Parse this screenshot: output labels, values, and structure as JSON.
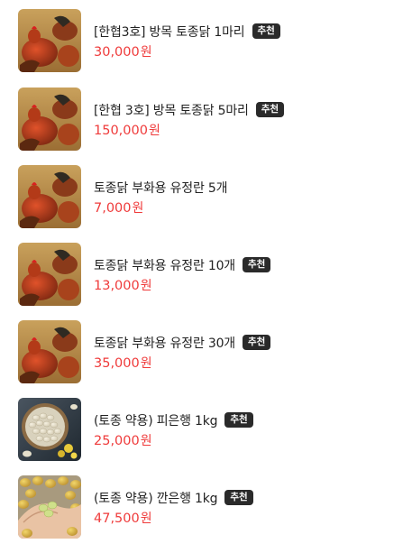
{
  "products": [
    {
      "name": "[한협3호] 방목 토종닭 1마리",
      "price": "30,000",
      "unit": "원",
      "badge": "추천",
      "image": "chicken-flock-photo"
    },
    {
      "name": "[한협 3호] 방목 토종닭 5마리",
      "price": "150,000",
      "unit": "원",
      "badge": "추천",
      "image": "chicken-flock-photo"
    },
    {
      "name": "토종닭 부화용 유정란 5개",
      "price": "7,000",
      "unit": "원",
      "badge": "",
      "image": "chicken-flock-photo"
    },
    {
      "name": "토종닭 부화용 유정란 10개",
      "price": "13,000",
      "unit": "원",
      "badge": "추천",
      "image": "chicken-flock-photo"
    },
    {
      "name": "토종닭 부화용 유정란 30개",
      "price": "35,000",
      "unit": "원",
      "badge": "추천",
      "image": "chicken-flock-photo"
    },
    {
      "name": "(토종 약용) 피은행 1kg",
      "price": "25,000",
      "unit": "원",
      "badge": "추천",
      "image": "ginkgo-nuts-bowl-photo"
    },
    {
      "name": "(토종 약용) 깐은행 1kg",
      "price": "47,500",
      "unit": "원",
      "badge": "추천",
      "image": "peeled-ginkgo-hand-photo"
    }
  ],
  "colors": {
    "price": "#ef3b3b",
    "badge_bg": "#2a2a2a",
    "text": "#222222"
  }
}
